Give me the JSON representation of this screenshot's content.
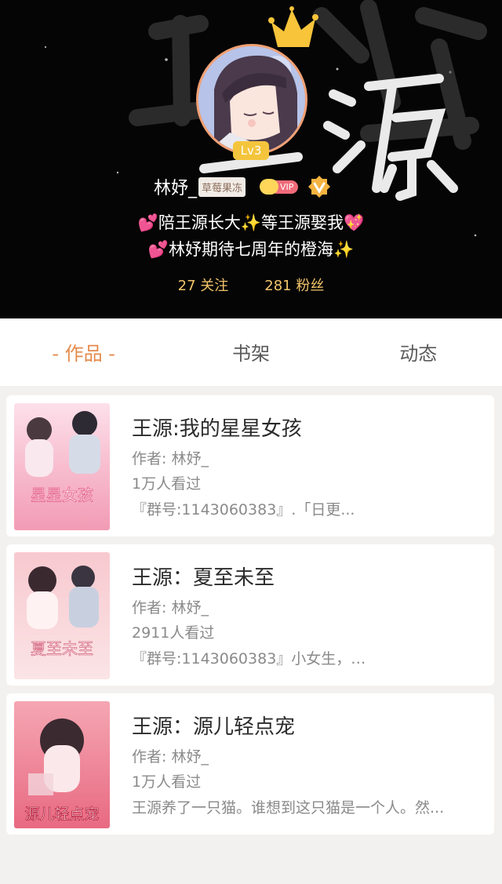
{
  "profile": {
    "level": "Lv3",
    "username": "林妤_",
    "name_tag": "草莓果冻",
    "vip_label": "VIP",
    "bio_line_1": "💕陪王源长大✨等王源娶我💖",
    "bio_line_2": "💕林妤期待七周年的橙海✨",
    "following": "27 关注",
    "followers": "281 粉丝",
    "colors": {
      "accent": "#e58a4c",
      "stats": "#f2c46a",
      "level_badge": "#f4c53c",
      "vip": "#f06b7a"
    }
  },
  "tabs": [
    {
      "label": "- 作品 -",
      "active": true
    },
    {
      "label": "书架",
      "active": false
    },
    {
      "label": "动态",
      "active": false
    }
  ],
  "books": [
    {
      "title": "王源:我的星星女孩",
      "author": "作者: 林妤_",
      "views": "1万人看过",
      "desc": "『群号:1143060383』.「日更...",
      "cover_text": "星星女孩"
    },
    {
      "title": "王源：夏至未至",
      "author": "作者: 林妤_",
      "views": "2911人看过",
      "desc": "『群号:1143060383』小女生，懵...",
      "cover_text": "夏至未至"
    },
    {
      "title": "王源：源儿轻点宠",
      "author": "作者: 林妤_",
      "views": "1万人看过",
      "desc": "王源养了一只猫。谁想到这只猫是一个人。然...",
      "cover_text": "源儿轻点宠"
    }
  ]
}
